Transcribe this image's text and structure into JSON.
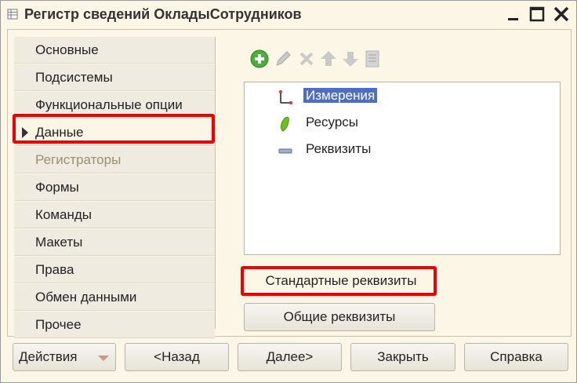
{
  "window": {
    "title": "Регистр сведений ОкладыСотрудников"
  },
  "sidebar": {
    "items": [
      {
        "label": "Основные",
        "state": "normal"
      },
      {
        "label": "Подсистемы",
        "state": "normal"
      },
      {
        "label": "Функциональные опции",
        "state": "normal"
      },
      {
        "label": "Данные",
        "state": "active"
      },
      {
        "label": "Регистраторы",
        "state": "disabled"
      },
      {
        "label": "Формы",
        "state": "normal"
      },
      {
        "label": "Команды",
        "state": "normal"
      },
      {
        "label": "Макеты",
        "state": "normal"
      },
      {
        "label": "Права",
        "state": "normal"
      },
      {
        "label": "Обмен данными",
        "state": "normal"
      },
      {
        "label": "Прочее",
        "state": "normal"
      }
    ]
  },
  "toolbar": {
    "icons": [
      "add-icon",
      "edit-icon",
      "delete-icon",
      "move-up-icon",
      "move-down-icon",
      "list-icon"
    ]
  },
  "tree": {
    "items": [
      {
        "label": "Измерения",
        "icon": "dimensions-icon",
        "selected": true
      },
      {
        "label": "Ресурсы",
        "icon": "resources-icon",
        "selected": false
      },
      {
        "label": "Реквизиты",
        "icon": "attributes-icon",
        "selected": false
      }
    ]
  },
  "links": {
    "standard_attributes": "Стандартные реквизиты",
    "common_attributes": "Общие реквизиты"
  },
  "bottom": {
    "actions": "Действия",
    "back": "<Назад",
    "next": "Далее>",
    "close": "Закрыть",
    "help": "Справка"
  },
  "colors": {
    "background": "#fbf6e6",
    "highlight": "#f00000",
    "selection": "#4d6ec4"
  }
}
